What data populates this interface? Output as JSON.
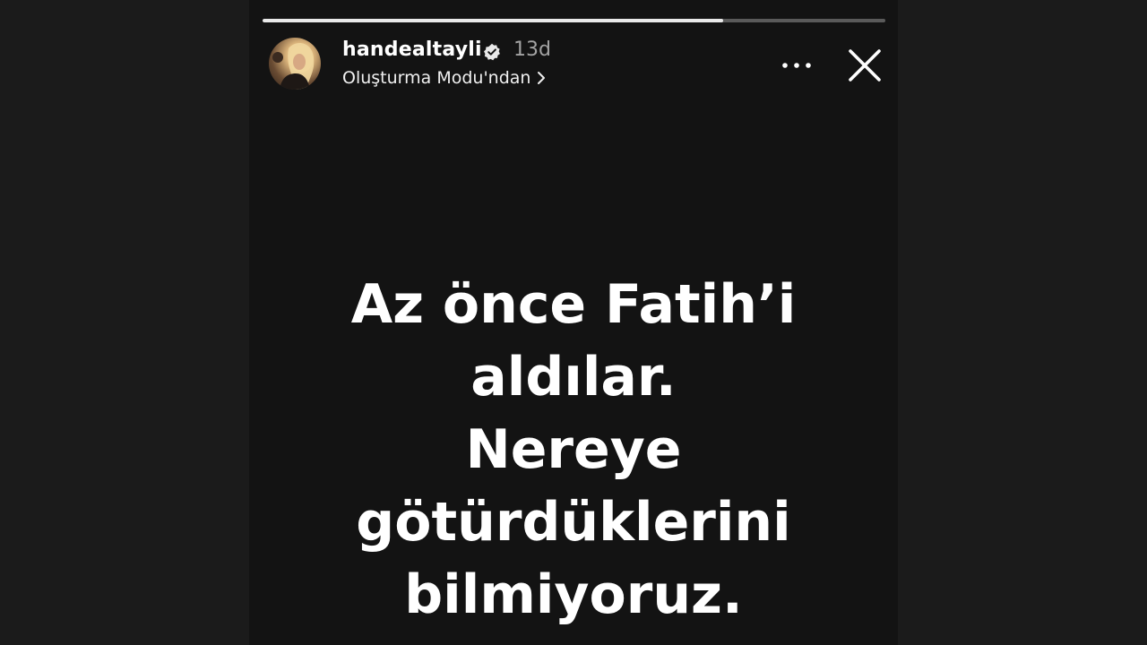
{
  "story": {
    "progress_fraction": 0.74,
    "header": {
      "username": "handealtayli",
      "verified": true,
      "time_ago": "13d",
      "subtitle": "Oluşturma Modu'ndan"
    },
    "icons": {
      "avatar": "profile-photo",
      "verified": "verified-badge-icon",
      "subtitle_chevron": "chevron-right-icon",
      "more": "more-horizontal-icon",
      "close": "close-icon"
    },
    "text_lines": [
      "Az önce Fatih’i",
      "aldılar.",
      "Nereye",
      "götürdüklerini",
      "bilmiyoruz."
    ]
  },
  "colors": {
    "page_background": "#1b1b1b",
    "story_background": "#131313",
    "text": "#ffffff",
    "muted_text": "#a3a3a3"
  }
}
